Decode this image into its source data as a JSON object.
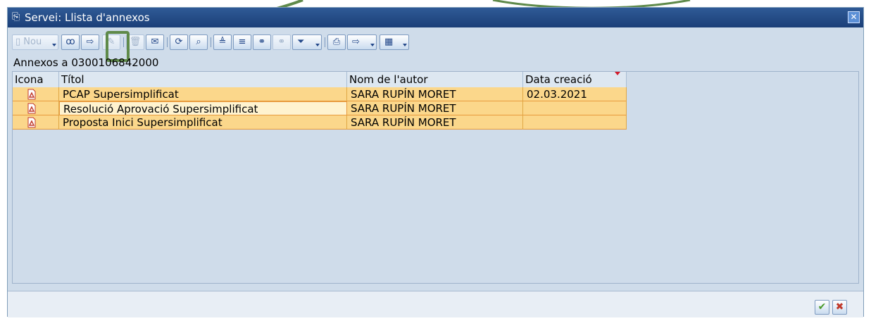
{
  "dialog": {
    "title": "Servei: Llista d'annexos",
    "close_icon": "close-icon"
  },
  "toolbar": {
    "new_label": "Nou",
    "icons": [
      "new-document-icon",
      "glasses-icon",
      "open-attachment-icon",
      "edit-pen-icon",
      "delete-icon",
      "text-document-icon",
      "refresh-icon",
      "details-icon",
      "sort-ascending-icon",
      "sort-descending-icon",
      "binoculars-icon",
      "find-next-icon",
      "filter-icon",
      "print-icon",
      "export-icon",
      "layout-icon"
    ]
  },
  "list": {
    "heading": "Annexos a 0300106842000",
    "columns": [
      "Icona",
      "Títol",
      "Nom de l'autor",
      "Data creació"
    ],
    "rows": [
      {
        "titol": "PCAP Supersimplificat",
        "autor": "SARA RUPÍN MORET",
        "data": "02.03.2021"
      },
      {
        "titol": "Resolució Aprovació Supersimplificat",
        "autor": "SARA RUPÍN MORET",
        "data": ""
      },
      {
        "titol": "Proposta Inici Supersimplificat",
        "autor": "SARA RUPÍN MORET",
        "data": ""
      }
    ]
  },
  "footer": {
    "confirm_icon": "checkmark-icon",
    "cancel_icon": "cancel-x-icon"
  },
  "colors": {
    "title_bar": "#2f5a96",
    "row_fill": "#fbd78b",
    "highlight": "#5f8a4a"
  }
}
